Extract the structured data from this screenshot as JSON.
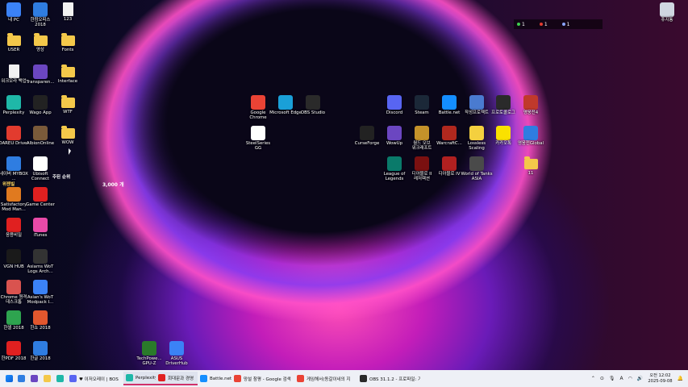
{
  "status_overlay": {
    "a": "1",
    "b": "1",
    "c": "1"
  },
  "floating_text": "3,000 개",
  "rank_text": "주된 순위",
  "rank_badge": "위젠빌",
  "desktop_icons": [
    {
      "label": "내 PC",
      "color": "#3b82f6",
      "kind": "app"
    },
    {
      "label": "한컴오피스 2018",
      "color": "#2f7de1",
      "kind": "app"
    },
    {
      "label": "123",
      "color": "#f2f2f2",
      "kind": "doc"
    },
    {
      "label": "USER",
      "color": "#f4c84a",
      "kind": "folder"
    },
    {
      "label": "영상",
      "color": "#f4c84a",
      "kind": "folder"
    },
    {
      "label": "Fonts",
      "color": "#f4c84a",
      "kind": "folder"
    },
    {
      "label": "워크오라 백업",
      "color": "#f2f2f2",
      "kind": "doc"
    },
    {
      "label": "Transparen...",
      "color": "#6b46c1",
      "kind": "app"
    },
    {
      "label": "Interface",
      "color": "#f4c84a",
      "kind": "folder"
    },
    {
      "label": "Perplexity",
      "color": "#1fb8a8",
      "kind": "app"
    },
    {
      "label": "Wago App",
      "color": "#222222",
      "kind": "app"
    },
    {
      "label": "WTF",
      "color": "#f4c84a",
      "kind": "folder"
    },
    {
      "label": "DAREU Driver",
      "color": "#e23b2e",
      "kind": "app"
    },
    {
      "label": "AlbionOnline",
      "color": "#7a5a3a",
      "kind": "app"
    },
    {
      "label": "WOW",
      "color": "#f4c84a",
      "kind": "folder"
    },
    {
      "label": "네이버 MYBOX ...",
      "color": "#2f7de1",
      "kind": "app"
    },
    {
      "label": "Ubisoft Connect",
      "color": "#ffffff",
      "kind": "app"
    },
    {
      "label": "Satisfactory Mod Man...",
      "color": "#e07a1f",
      "kind": "app"
    },
    {
      "label": "Game Center",
      "color": "#e02020",
      "kind": "app"
    },
    {
      "label": "응용비밀",
      "color": "#e02020",
      "kind": "app"
    },
    {
      "label": "iTunes",
      "color": "#e94aa8",
      "kind": "app"
    },
    {
      "label": "VGN HUB",
      "color": "#1a1a1a",
      "kind": "app"
    },
    {
      "label": "Asiams WoT Logs Arch...",
      "color": "#333333",
      "kind": "app"
    },
    {
      "label": "Chrome 원격 데스크톱",
      "color": "#d9534f",
      "kind": "app"
    },
    {
      "label": "Asian's WoT Modpack I...",
      "color": "#3b82f6",
      "kind": "app"
    },
    {
      "label": "한셀 2018",
      "color": "#2ea44f",
      "kind": "app"
    },
    {
      "label": "한쇼 2018",
      "color": "#e2572e",
      "kind": "app"
    },
    {
      "label": "한PDF 2018",
      "color": "#e02020",
      "kind": "app"
    },
    {
      "label": "한글 2018",
      "color": "#2f7de1",
      "kind": "app"
    },
    {
      "label": "Google Chrome",
      "color": "#ea4335",
      "kind": "app"
    },
    {
      "label": "Microsoft Edge",
      "color": "#1aa0d8",
      "kind": "app"
    },
    {
      "label": "OBS Studio",
      "color": "#2a2a2a",
      "kind": "app"
    },
    {
      "label": "SteelSeries GG",
      "color": "#ffffff",
      "kind": "app"
    },
    {
      "label": "Discord",
      "color": "#5865f2",
      "kind": "app"
    },
    {
      "label": "Steam",
      "color": "#1b2838",
      "kind": "app"
    },
    {
      "label": "Battle.net",
      "color": "#148eff",
      "kind": "app"
    },
    {
      "label": "작성프로젝트",
      "color": "#4a7bd0",
      "kind": "app"
    },
    {
      "label": "프로토콜로그",
      "color": "#2a2a2a",
      "kind": "app"
    },
    {
      "label": "영웅전4",
      "color": "#c0392b",
      "kind": "app"
    },
    {
      "label": "CurseForge",
      "color": "#222222",
      "kind": "app"
    },
    {
      "label": "WowUp",
      "color": "#6b46c1",
      "kind": "app"
    },
    {
      "label": "월드 오브 워크래프트",
      "color": "#c4922a",
      "kind": "app"
    },
    {
      "label": "WarcraftC...",
      "color": "#b0281e",
      "kind": "app"
    },
    {
      "label": "Lossless Scaling",
      "color": "#f4d03f",
      "kind": "app"
    },
    {
      "label": "카카오톡",
      "color": "#fae100",
      "kind": "app"
    },
    {
      "label": "영웅전Global",
      "color": "#2f7de1",
      "kind": "app"
    },
    {
      "label": "League of Legends",
      "color": "#0a7a6a",
      "kind": "app"
    },
    {
      "label": "디아블로 II 레저렉션",
      "color": "#7a1010",
      "kind": "app"
    },
    {
      "label": "디아블로 IV",
      "color": "#b02020",
      "kind": "app"
    },
    {
      "label": "World of Tanks ASIA",
      "color": "#4a4a4a",
      "kind": "app"
    },
    {
      "label": "11",
      "color": "#f4c84a",
      "kind": "folder"
    },
    {
      "label": "TechPowe... GPU-Z",
      "color": "#2a7a2a",
      "kind": "app"
    },
    {
      "label": "ASUS DriverHub",
      "color": "#3b82f6",
      "kind": "app"
    },
    {
      "label": "휴지통",
      "color": "#cfd6e0",
      "kind": "app"
    }
  ],
  "taskbar": {
    "items": [
      {
        "label": "",
        "color": "#2f7de1"
      },
      {
        "label": "",
        "color": "#6b46c1"
      },
      {
        "label": "",
        "color": "#f4c84a"
      },
      {
        "label": "",
        "color": "#1fb8a8"
      },
      {
        "label": "♥ 이저오레이 | BOS",
        "color": "#5865f2"
      },
      {
        "label": "Perplexity",
        "color": "#1fb8a8"
      },
      {
        "label": "회대문과 경영",
        "color": "#e02020"
      },
      {
        "label": "Battle.net",
        "color": "#148eff"
      },
      {
        "label": "망설 참평 - Google 검색",
        "color": "#ea4335"
      },
      {
        "label": "게임해서(동갈이네의 지",
        "color": "#ea4335"
      },
      {
        "label": "OBS 31.1.2 - 프로파일: 기",
        "color": "#2a2a2a"
      }
    ],
    "tray_time": "오전 12:02",
    "tray_date": "2025-09-08"
  }
}
